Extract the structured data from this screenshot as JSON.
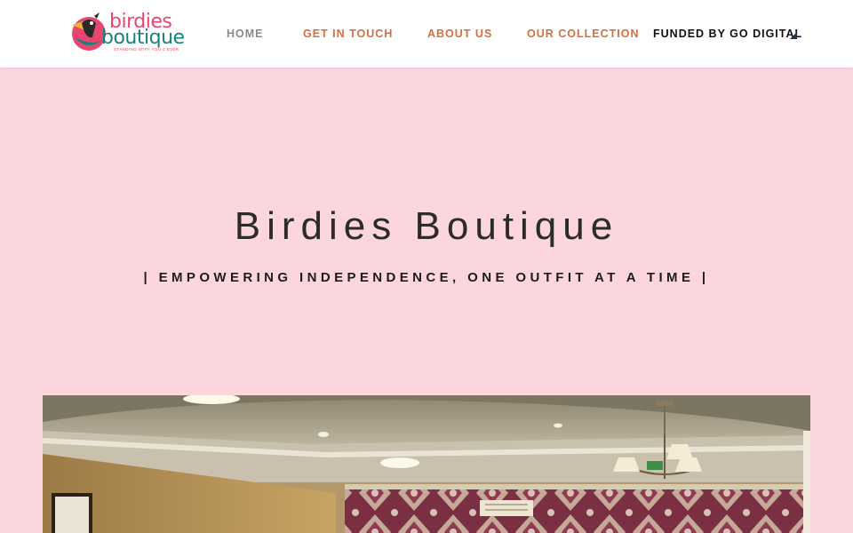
{
  "header": {
    "logo": {
      "word1": "birdies",
      "word2": "boutique",
      "tagline": "STANDING WITH YOU 4 EVER",
      "icon": "bird-logo-icon"
    },
    "nav": [
      {
        "label": "HOME",
        "color": "#8a8a8a"
      },
      {
        "label": "GET IN TOUCH",
        "color": "#d2703e"
      },
      {
        "label": "ABOUT US",
        "color": "#d2703e"
      },
      {
        "label": "OUR COLLECTION",
        "color": "#d2703e"
      },
      {
        "label": "FUNDED BY GO DIGITAL",
        "color": "#111111",
        "icon": "dropdown-triangle-icon"
      }
    ]
  },
  "hero": {
    "title": "Birdies Boutique",
    "subtitle": "| EMPOWERING INDEPENDENCE, ONE OUTFIT AT A TIME |"
  },
  "photo": {
    "subject": "boutique-interior-photo"
  },
  "colors": {
    "background": "#fbd7dd",
    "accent": "#d2703e",
    "brand_pink": "#e8466e",
    "brand_teal": "#17837f"
  }
}
